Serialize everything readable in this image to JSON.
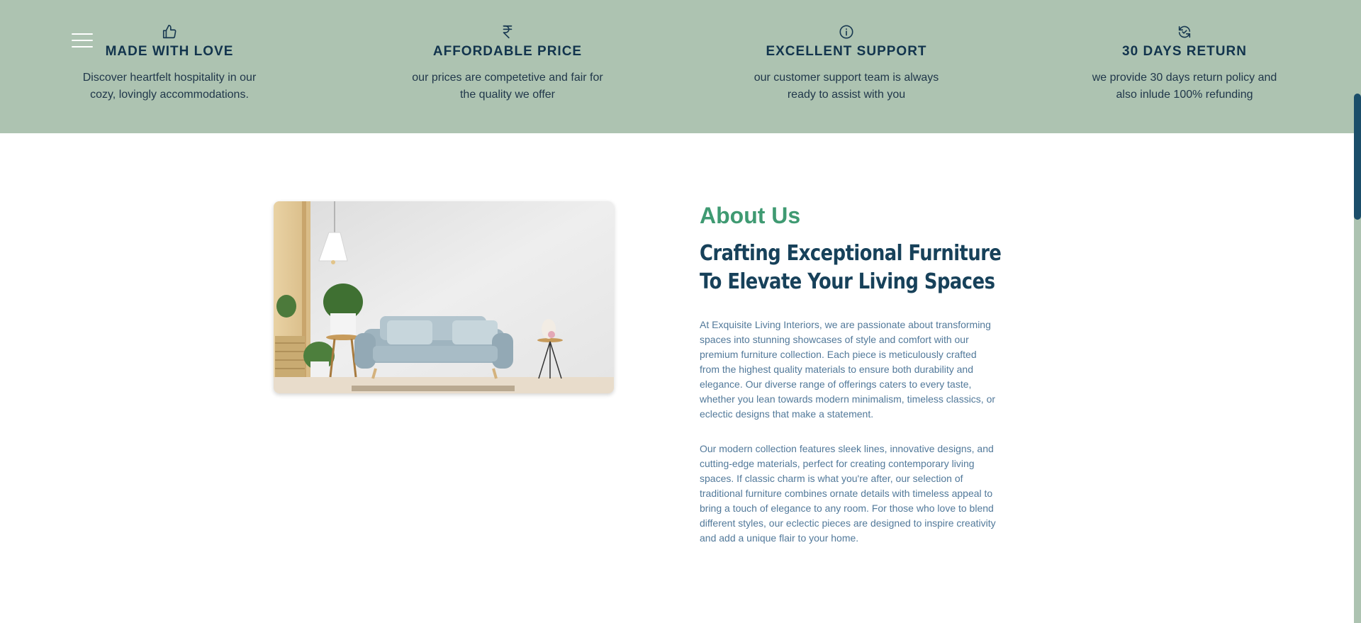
{
  "menu": {
    "icon": "hamburger-menu-icon"
  },
  "features": [
    {
      "icon": "thumbs-up-icon",
      "title": "MADE WITH LOVE",
      "text": "Discover heartfelt hospitality in our cozy, lovingly accommodations."
    },
    {
      "icon": "rupee-icon",
      "title": "AFFORDABLE PRICE",
      "text": "our prices are competetive and fair for the quality we offer"
    },
    {
      "icon": "info-icon",
      "title": "EXCELLENT SUPPORT",
      "text": "our customer support team is always ready to assist with you"
    },
    {
      "icon": "refresh-icon",
      "title": "30 DAYS RETURN",
      "text": "we provide 30 days return policy and also inlude 100% refunding"
    }
  ],
  "about": {
    "kicker": "About Us",
    "heading": "Crafting Exceptional Furniture To Elevate Your Living Spaces",
    "paragraphs": [
      "At Exquisite Living Interiors, we are passionate about transforming spaces into stunning showcases of style and comfort with our premium furniture collection. Each piece is meticulously crafted from the highest quality materials to ensure both durability and elegance. Our diverse range of offerings caters to every taste, whether you lean towards modern minimalism, timeless classics, or eclectic designs that make a statement.",
      "Our modern collection features sleek lines, innovative designs, and cutting-edge materials, perfect for creating contemporary living spaces. If classic charm is what you're after, our selection of traditional furniture combines ornate details with timeless appeal to bring a touch of elegance to any room. For those who love to blend different styles, our eclectic pieces are designed to inspire creativity and add a unique flair to your home."
    ]
  },
  "colors": {
    "features_bg": "#adc3b1",
    "accent_green": "#3f9a72",
    "heading_navy": "#17415a",
    "body_blue": "#52799a"
  }
}
